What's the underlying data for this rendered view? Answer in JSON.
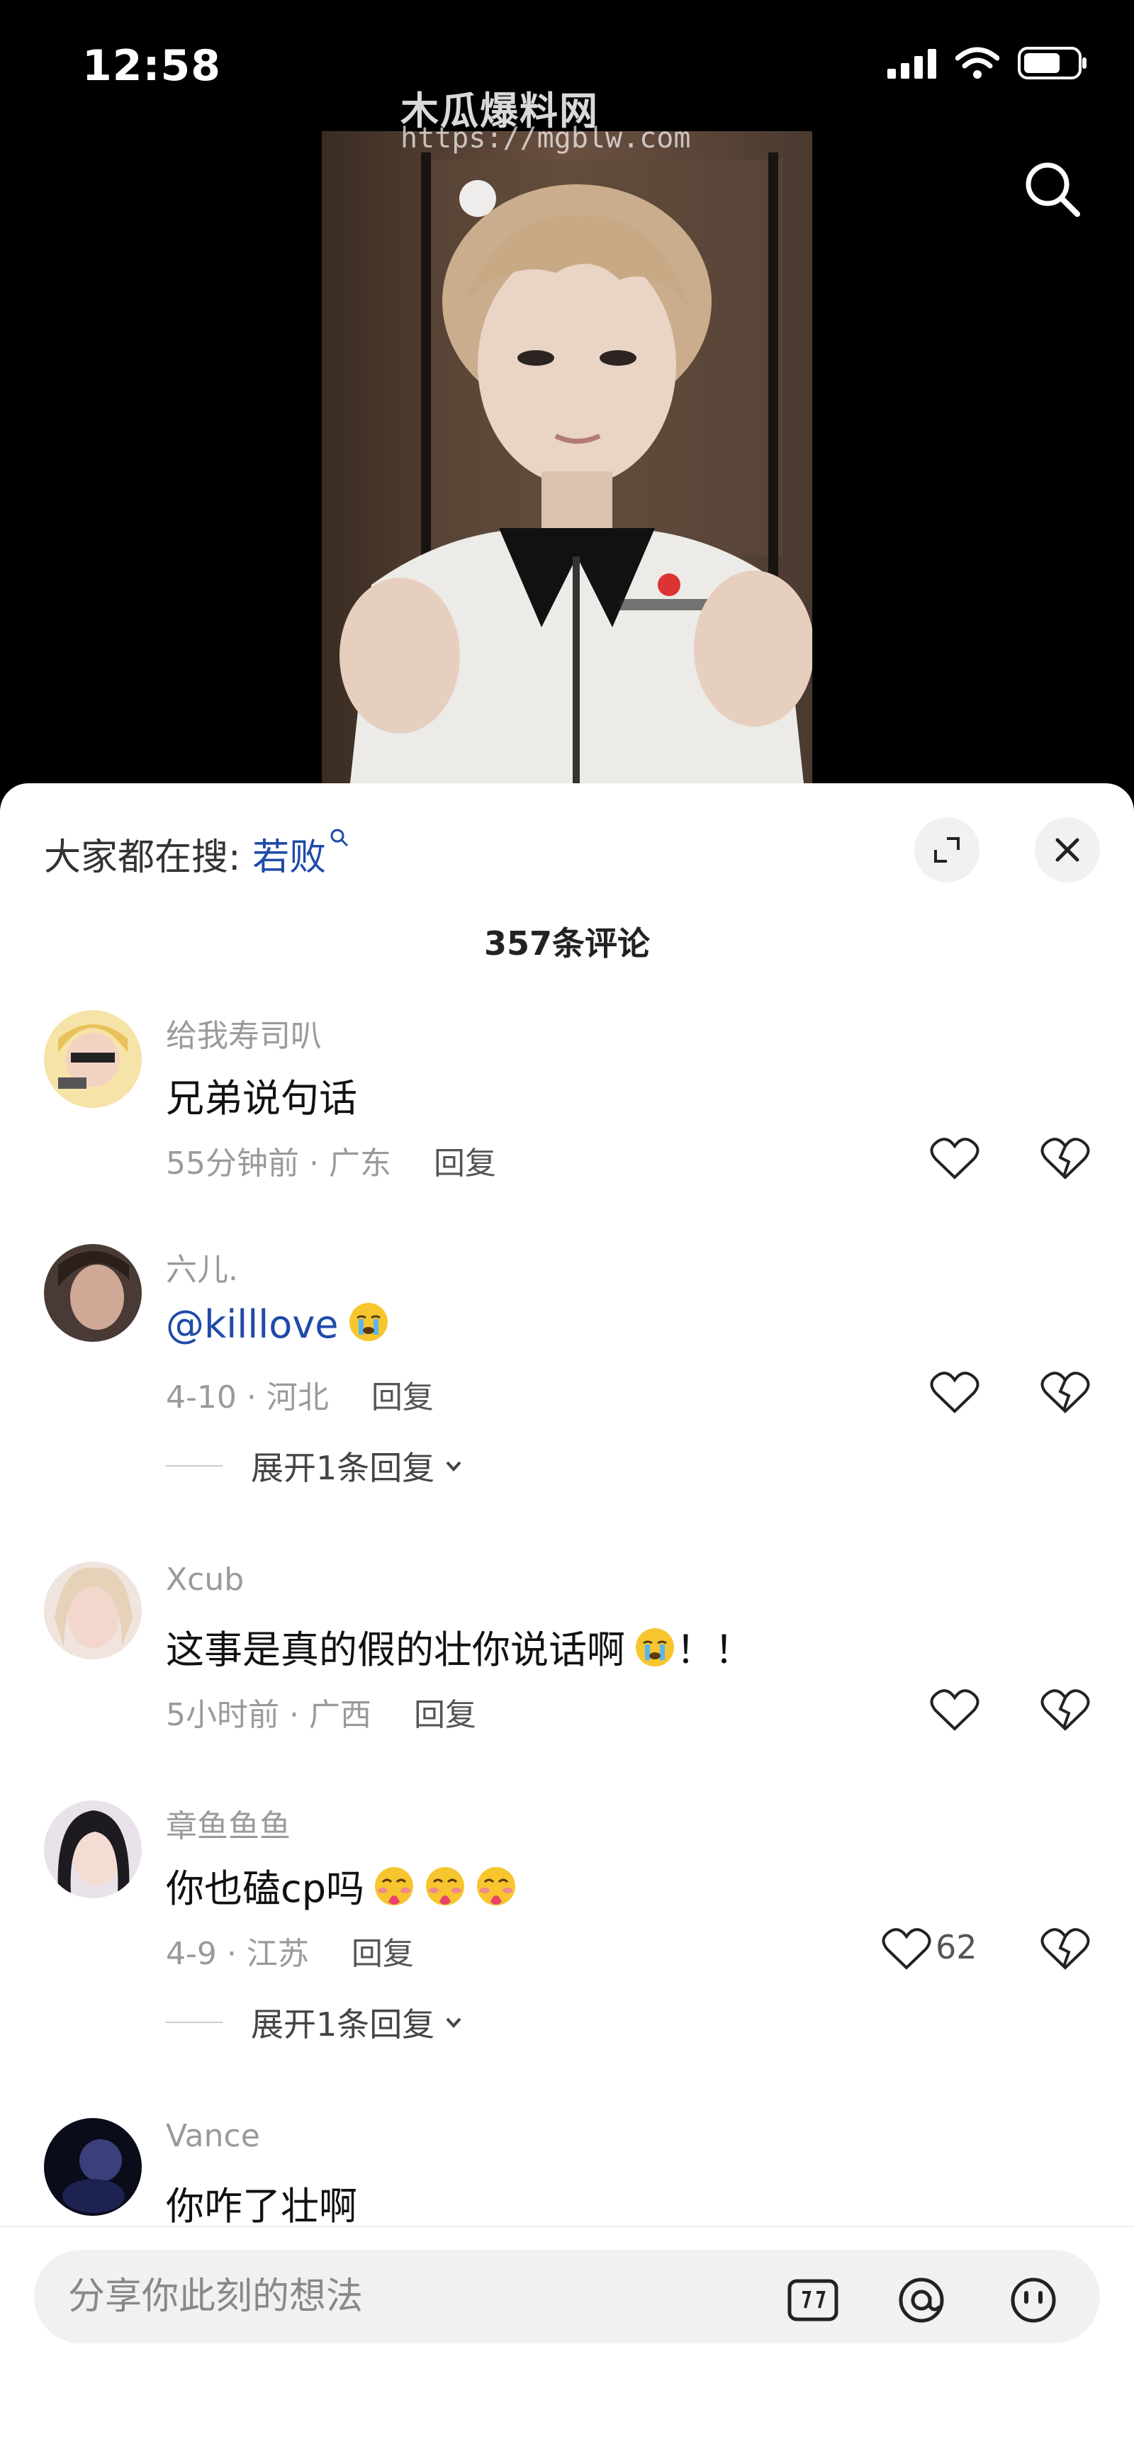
{
  "status": {
    "time": "12:58"
  },
  "watermark": {
    "title": "木瓜爆料网",
    "url": "https://mgblw.com"
  },
  "trending": {
    "prefix": "大家都在搜: ",
    "keyword": "若败"
  },
  "comment_count": "357条评论",
  "comments": [
    {
      "user": "给我寿司叭",
      "text": "兄弟说句话",
      "meta": "55分钟前 · 广东",
      "reply": "回复"
    },
    {
      "user": "六儿.",
      "mention": "@killlove",
      "meta": "4-10 · 河北",
      "reply": "回复",
      "expand": "展开1条回复"
    },
    {
      "user": "Xcub",
      "text": "这事是真的假的壮你说话啊",
      "suffix": "！！",
      "meta": "5小时前 · 广西",
      "reply": "回复"
    },
    {
      "user": "章鱼鱼鱼",
      "text": "你也磕cp吗",
      "meta": "4-9 · 江苏",
      "reply": "回复",
      "likes": "62",
      "expand": "展开1条回复"
    },
    {
      "user": "Vance",
      "text": "你咋了壮啊"
    }
  ],
  "input": {
    "placeholder": "分享你此刻的想法"
  },
  "icons": [
    "search-icon",
    "expand-icon",
    "close-icon",
    "heart-icon",
    "broken-heart-icon",
    "crying-emoji-icon",
    "blushing-emoji-icon",
    "image-icon",
    "at-icon",
    "emoji-icon"
  ]
}
